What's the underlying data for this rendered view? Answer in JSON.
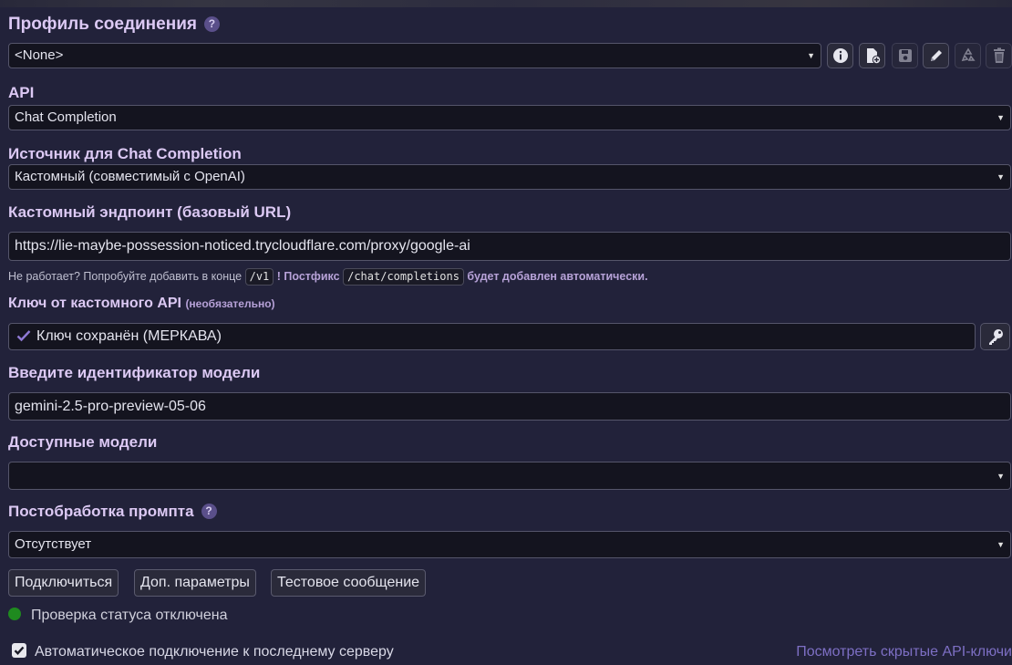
{
  "profile": {
    "title": "Профиль соединения",
    "selected": "<None>"
  },
  "api": {
    "label": "API",
    "selected": "Chat Completion"
  },
  "source": {
    "label": "Источник для Chat Completion",
    "selected": "Кастомный (совместимый с OpenAI)"
  },
  "endpoint": {
    "label": "Кастомный эндпоинт (базовый URL)",
    "value": "https://lie-maybe-possession-noticed.trycloudflare.com/proxy/google-ai",
    "hint_prefix": "Не работает? Попробуйте добавить в конце",
    "hint_code1": "/v1",
    "hint_mid": "! Постфикс",
    "hint_code2": "/chat/completions",
    "hint_suffix": "будет добавлен автоматически."
  },
  "key": {
    "label": "Ключ от кастомного API",
    "optional": "(необязательно)",
    "value": "Ключ сохранён (МЕРКАВА)"
  },
  "model": {
    "label": "Введите идентификатор модели",
    "value": "gemini-2.5-pro-preview-05-06"
  },
  "available": {
    "label": "Доступные модели",
    "selected": ""
  },
  "postprocess": {
    "label": "Постобработка промпта",
    "selected": "Отсутствует"
  },
  "buttons": {
    "connect": "Подключиться",
    "extra": "Доп. параметры",
    "test": "Тестовое сообщение"
  },
  "status": {
    "text": "Проверка статуса отключена",
    "color": "#1f8a1f"
  },
  "auto_connect": {
    "label": "Автоматическое подключение к последнему серверу",
    "checked": true
  },
  "hidden_keys_link": "Посмотреть скрытые API-ключи",
  "icons": [
    "info-icon",
    "file-plus-icon",
    "save-icon",
    "pencil-icon",
    "recycle-icon",
    "trash-icon",
    "check-icon",
    "key-icon"
  ]
}
